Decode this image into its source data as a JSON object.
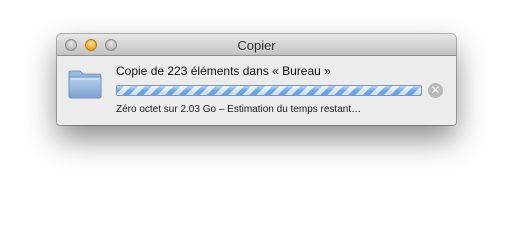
{
  "window": {
    "title": "Copier"
  },
  "copy": {
    "message": "Copie de 223 éléments dans « Bureau »",
    "progress": 1.0,
    "status": "Zéro octet sur 2.03 Go – Estimation du temps restant…",
    "cancel_icon": "✕"
  },
  "icons": {
    "item": "folder-icon",
    "cancel": "cancel-circle-icon"
  },
  "colors": {
    "progress_stripe": "#6fa5e6",
    "progress_stripe_light": "#d9e8fa",
    "folder": "#8fb1d8",
    "cancel": "#b9b9b9"
  }
}
